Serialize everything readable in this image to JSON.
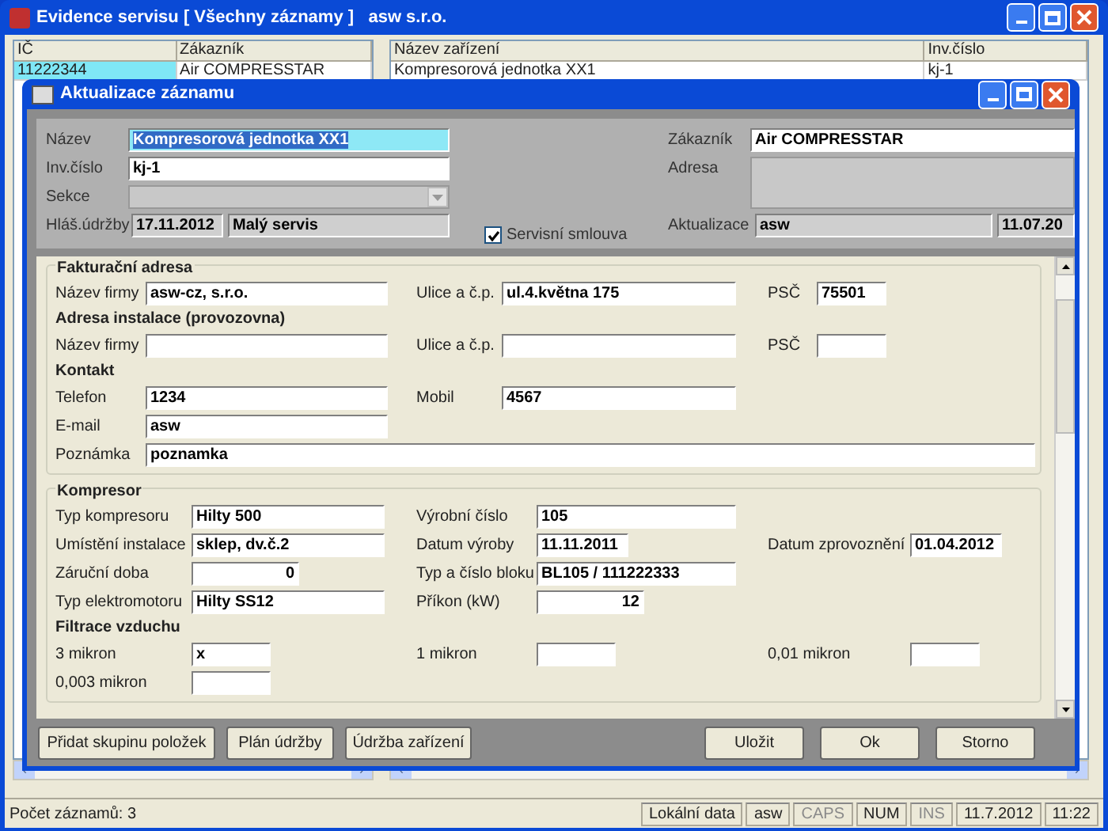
{
  "window": {
    "title": "Evidence servisu [ Všechny záznamy ]   asw s.r.o."
  },
  "left_table": {
    "columns": [
      "IČ",
      "Zákazník"
    ],
    "rows": [
      {
        "cells": [
          "11222344",
          "Air COMPRESSTAR"
        ],
        "selected": true
      }
    ]
  },
  "right_table": {
    "columns": [
      "Název zařízení",
      "Inv.číslo"
    ],
    "rows": [
      {
        "cells": [
          "Kompresorová jednotka XX1",
          "kj-1"
        ],
        "selected": false
      }
    ]
  },
  "dialog": {
    "title": "Aktualizace záznamu",
    "header": {
      "name": {
        "label": "Název",
        "value": "Kompresorová jednotka XX1"
      },
      "inv": {
        "label": "Inv.číslo",
        "value": "kj-1"
      },
      "section": {
        "label": "Sekce",
        "disabled": true
      },
      "report": {
        "label": "Hláš.údržby",
        "date": "17.11.2012",
        "type": "Malý servis"
      },
      "contract": {
        "label": "Servisní smlouva",
        "checked": true
      },
      "customer": {
        "label": "Zákazník",
        "value": "Air COMPRESSTAR"
      },
      "address": {
        "label": "Adresa"
      },
      "update": {
        "label": "Aktualizace",
        "user": "asw",
        "date": "11.07.20"
      }
    },
    "sections": [
      {
        "title": "Fakturační adresa",
        "rows": [
          {
            "kind": "fields",
            "fields": [
              {
                "label": "Název firmy",
                "value": "asw-cz, s.r.o.",
                "kind": "text"
              },
              {
                "label": "Ulice a č.p.",
                "value": "ul.4.května 175",
                "kind": "text"
              },
              {
                "label": "PSČ",
                "value": "75501",
                "kind": "short"
              }
            ]
          },
          {
            "kind": "heading",
            "text": "Adresa instalace (provozovna)"
          },
          {
            "kind": "fields",
            "fields": [
              {
                "label": "Název firmy",
                "kind": "text"
              },
              {
                "label": "Ulice a č.p.",
                "kind": "text"
              },
              {
                "label": "PSČ",
                "kind": "short"
              }
            ]
          },
          {
            "kind": "heading",
            "text": "Kontakt"
          },
          {
            "kind": "fields",
            "fields": [
              {
                "label": "Telefon",
                "value": "1234",
                "kind": "text"
              },
              {
                "label": "Mobil",
                "value": "4567",
                "kind": "text"
              }
            ]
          },
          {
            "kind": "fields",
            "fields": [
              {
                "label": "E-mail",
                "value": "asw",
                "kind": "text"
              }
            ]
          },
          {
            "kind": "fields",
            "fields": [
              {
                "label": "Poznámka",
                "value": "poznamka",
                "kind": "wide"
              }
            ]
          }
        ]
      },
      {
        "title": "Kompresor",
        "rows": [
          {
            "kind": "fields",
            "fields": [
              {
                "label": "Typ kompresoru",
                "value": "Hilty 500",
                "kind": "text"
              },
              {
                "label": "Výrobní číslo",
                "value": "105",
                "kind": "text"
              }
            ]
          },
          {
            "kind": "fields",
            "fields": [
              {
                "label": "Umístění instalace",
                "value": "sklep, dv.č.2",
                "kind": "text"
              },
              {
                "label": "Datum výroby",
                "value": "11.11.2011",
                "kind": "date"
              },
              {
                "label": "Datum zprovoznění",
                "value": "01.04.2012",
                "kind": "date"
              }
            ]
          },
          {
            "kind": "fields",
            "fields": [
              {
                "label": "Záruční doba",
                "value": "0",
                "kind": "number"
              },
              {
                "label": "Typ a číslo bloku",
                "value": "BL105 / 111222333",
                "kind": "text"
              }
            ]
          },
          {
            "kind": "fields",
            "fields": [
              {
                "label": "Typ elektromotoru",
                "value": "Hilty SS12",
                "kind": "text"
              },
              {
                "label": "Příkon (kW)",
                "value": "12",
                "kind": "number"
              }
            ]
          },
          {
            "kind": "heading",
            "text": "Filtrace vzduchu"
          },
          {
            "kind": "fields",
            "fields": [
              {
                "label": "3 mikron",
                "value": "x",
                "kind": "short"
              },
              {
                "label": "1 mikron",
                "kind": "short"
              },
              {
                "label": "0,01 mikron",
                "kind": "short"
              }
            ]
          },
          {
            "kind": "fields",
            "fields": [
              {
                "label": "0,003 mikron",
                "kind": "short"
              }
            ]
          }
        ]
      }
    ],
    "left_buttons": [
      "Přidat skupinu položek",
      "Plán údržby",
      "Údržba zařízení"
    ],
    "right_buttons": [
      "Uložit",
      "Ok",
      "Storno"
    ]
  },
  "status_bar": {
    "text": "Počet záznamů: 3",
    "panels": [
      {
        "text": "Lokální data",
        "disabled": false
      },
      {
        "text": "asw",
        "disabled": false
      },
      {
        "text": "CAPS",
        "disabled": true
      },
      {
        "text": "NUM",
        "disabled": false
      },
      {
        "text": "INS",
        "disabled": true
      },
      {
        "text": "11.7.2012",
        "disabled": false
      },
      {
        "text": "11:22",
        "disabled": false
      }
    ]
  }
}
